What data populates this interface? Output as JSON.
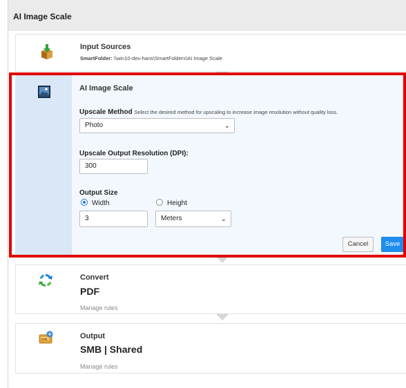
{
  "app": {
    "title": "AI Image Scale"
  },
  "input_sources": {
    "title": "Input Sources",
    "path_label": "SmartFolder:",
    "path_value": "\\\\win10-dev-hans\\SmartFolders\\AI Image Scale"
  },
  "ai_scale": {
    "title": "AI Image Scale",
    "upscale_method_label": "Upscale Method",
    "upscale_method_hint": "Select the desired method for upscaling to increase image resolution without quality loss.",
    "upscale_method_value": "Photo",
    "resolution_label": "Upscale Output Resolution (DPI):",
    "resolution_value": "300",
    "output_size_label": "Output Size",
    "width_label": "Width",
    "height_label": "Height",
    "size_value": "3",
    "unit_value": "Meters",
    "cancel_label": "Cancel",
    "save_label": "Save"
  },
  "convert": {
    "title": "Convert",
    "value": "PDF",
    "manage_rules": "Manage rules"
  },
  "output": {
    "title": "Output",
    "value": "SMB | Shared",
    "manage_rules": "Manage rules"
  },
  "icons": {
    "input": "download-box-icon",
    "scale": "image-icon",
    "convert": "refresh-icon",
    "output": "smb-drive-icon"
  },
  "colors": {
    "highlight": "#e00000",
    "save_button": "#1d8ef0",
    "panel_bg": "#f2f8fd",
    "panel_icon_col": "#d9e7f7"
  }
}
